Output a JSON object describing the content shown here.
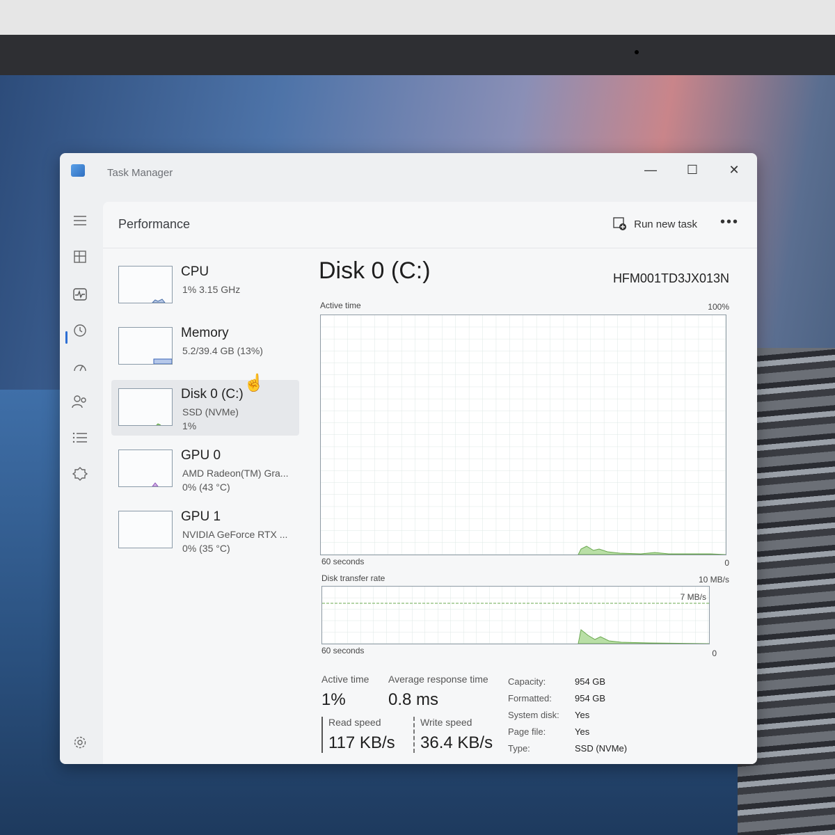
{
  "window": {
    "title": "Task Manager",
    "minimize": "—",
    "maximize": "☐",
    "close": "✕"
  },
  "nav": [
    "menu-icon",
    "processes-icon",
    "performance-icon",
    "app-history-icon",
    "startup-icon",
    "users-icon",
    "details-icon",
    "services-icon",
    "settings-icon"
  ],
  "header": {
    "title": "Performance",
    "run_new_task": "Run new task",
    "more": "•••"
  },
  "devices": [
    {
      "name": "CPU",
      "line1": "1%  3.15 GHz",
      "line2": ""
    },
    {
      "name": "Memory",
      "line1": "5.2/39.4 GB (13%)",
      "line2": ""
    },
    {
      "name": "Disk 0 (C:)",
      "line1": "SSD (NVMe)",
      "line2": "1%"
    },
    {
      "name": "GPU 0",
      "line1": "AMD Radeon(TM) Gra...",
      "line2": "0%  (43 °C)"
    },
    {
      "name": "GPU 1",
      "line1": "NVIDIA GeForce RTX ...",
      "line2": "0%  (35 °C)"
    }
  ],
  "detail": {
    "title": "Disk 0 (C:)",
    "model": "HFM001TD3JX013N",
    "active_time_label": "Active time",
    "active_time_max": "100%",
    "time_span_1": "60 seconds",
    "zero_1": "0",
    "transfer_label": "Disk transfer rate",
    "transfer_max": "10 MB/s",
    "transfer_inner": "7 MB/s",
    "time_span_2": "60 seconds",
    "zero_2": "0"
  },
  "stats": {
    "active_time_label": "Active time",
    "active_time_value": "1%",
    "avg_resp_label": "Average response time",
    "avg_resp_value": "0.8 ms",
    "read_label": "Read speed",
    "read_value": "117 KB/s",
    "write_label": "Write speed",
    "write_value": "36.4 KB/s",
    "props": [
      {
        "k": "Capacity:",
        "v": "954 GB"
      },
      {
        "k": "Formatted:",
        "v": "954 GB"
      },
      {
        "k": "System disk:",
        "v": "Yes"
      },
      {
        "k": "Page file:",
        "v": "Yes"
      },
      {
        "k": "Type:",
        "v": "SSD (NVMe)"
      }
    ]
  },
  "colors": {
    "graph_fill": "#b9dfa6",
    "graph_line": "#6aa84f",
    "accent": "#2d6fd4"
  }
}
